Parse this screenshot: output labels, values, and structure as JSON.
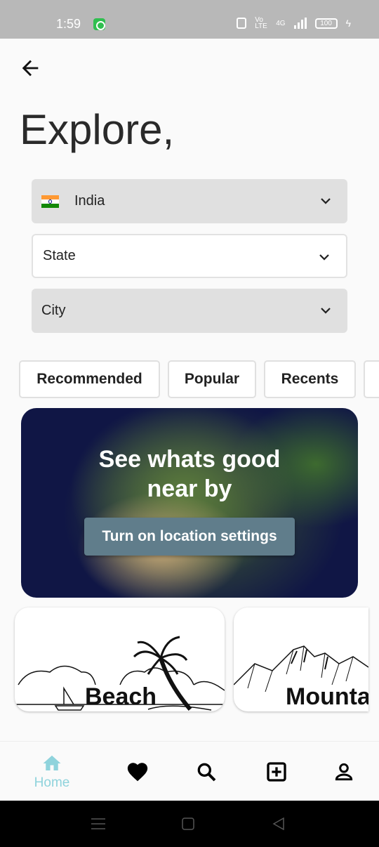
{
  "status": {
    "time": "1:59",
    "battery": "100",
    "network": "Vo LTE",
    "net_gen": "4G"
  },
  "page": {
    "title": "Explore,"
  },
  "filters": {
    "country": {
      "value": "India",
      "flag_colors": [
        "#ff9933",
        "#ffffff",
        "#138808"
      ]
    },
    "state": {
      "value": "State"
    },
    "city": {
      "value": "City"
    }
  },
  "tabs": [
    {
      "label": "Recommended"
    },
    {
      "label": "Popular"
    },
    {
      "label": "Recents"
    }
  ],
  "banner": {
    "line1": "See whats good",
    "line2": "near by",
    "button": "Turn on location settings"
  },
  "categories": [
    {
      "label": "Beach"
    },
    {
      "label": "Mountain"
    }
  ],
  "nav": {
    "home": {
      "label": "Home",
      "icon": "home-icon",
      "active": true
    },
    "items": [
      "heart-icon",
      "search-icon",
      "add-box-icon",
      "person-icon"
    ],
    "active_color": "#8fd3dc"
  }
}
